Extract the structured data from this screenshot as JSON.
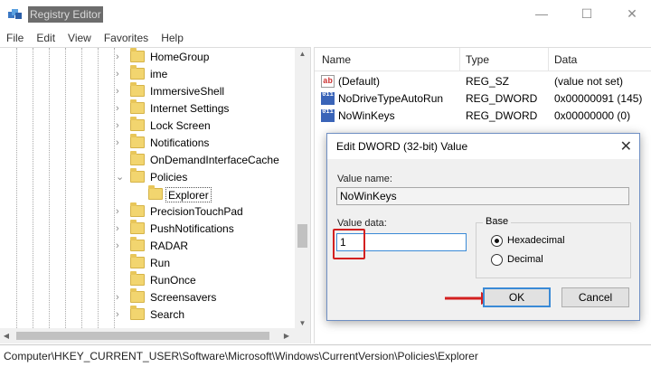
{
  "window": {
    "title": "Registry Editor",
    "min_glyph": "—",
    "max_glyph": "☐",
    "close_glyph": "✕"
  },
  "menu": [
    "File",
    "Edit",
    "View",
    "Favorites",
    "Help"
  ],
  "tree": {
    "items": [
      {
        "label": "HomeGroup",
        "expander": "›"
      },
      {
        "label": "ime",
        "expander": "›"
      },
      {
        "label": "ImmersiveShell",
        "expander": "›"
      },
      {
        "label": "Internet Settings",
        "expander": "›"
      },
      {
        "label": "Lock Screen",
        "expander": "›"
      },
      {
        "label": "Notifications",
        "expander": "›"
      },
      {
        "label": "OnDemandInterfaceCache",
        "expander": ""
      },
      {
        "label": "Policies",
        "expander": "⌄"
      },
      {
        "label": "Explorer",
        "expander": ""
      },
      {
        "label": "PrecisionTouchPad",
        "expander": "›"
      },
      {
        "label": "PushNotifications",
        "expander": "›"
      },
      {
        "label": "RADAR",
        "expander": "›"
      },
      {
        "label": "Run",
        "expander": ""
      },
      {
        "label": "RunOnce",
        "expander": ""
      },
      {
        "label": "Screensavers",
        "expander": "›"
      },
      {
        "label": "Search",
        "expander": "›"
      }
    ],
    "selected": "Explorer"
  },
  "list": {
    "columns": [
      "Name",
      "Type",
      "Data"
    ],
    "rows": [
      {
        "icon": "string-value-icon",
        "badge": "ab",
        "name": "(Default)",
        "type": "REG_SZ",
        "data": "(value not set)"
      },
      {
        "icon": "binary-value-icon",
        "badge": "011",
        "name": "NoDriveTypeAutoRun",
        "type": "REG_DWORD",
        "data": "0x00000091 (145)"
      },
      {
        "icon": "binary-value-icon",
        "badge": "011",
        "name": "NoWinKeys",
        "type": "REG_DWORD",
        "data": "0x00000000 (0)"
      }
    ]
  },
  "dialog": {
    "title": "Edit DWORD (32-bit) Value",
    "value_name_label": "Value name:",
    "value_name": "NoWinKeys",
    "value_data_label": "Value data:",
    "value_data": "1",
    "base_label": "Base",
    "base_options": [
      "Hexadecimal",
      "Decimal"
    ],
    "base_selected": "Hexadecimal",
    "ok_label": "OK",
    "cancel_label": "Cancel"
  },
  "status_path": "Computer\\HKEY_CURRENT_USER\\Software\\Microsoft\\Windows\\CurrentVersion\\Policies\\Explorer",
  "colors": {
    "annotation_red": "#d32020",
    "folder_yellow": "#f2d56f",
    "accent_blue": "#3a8ad6"
  }
}
